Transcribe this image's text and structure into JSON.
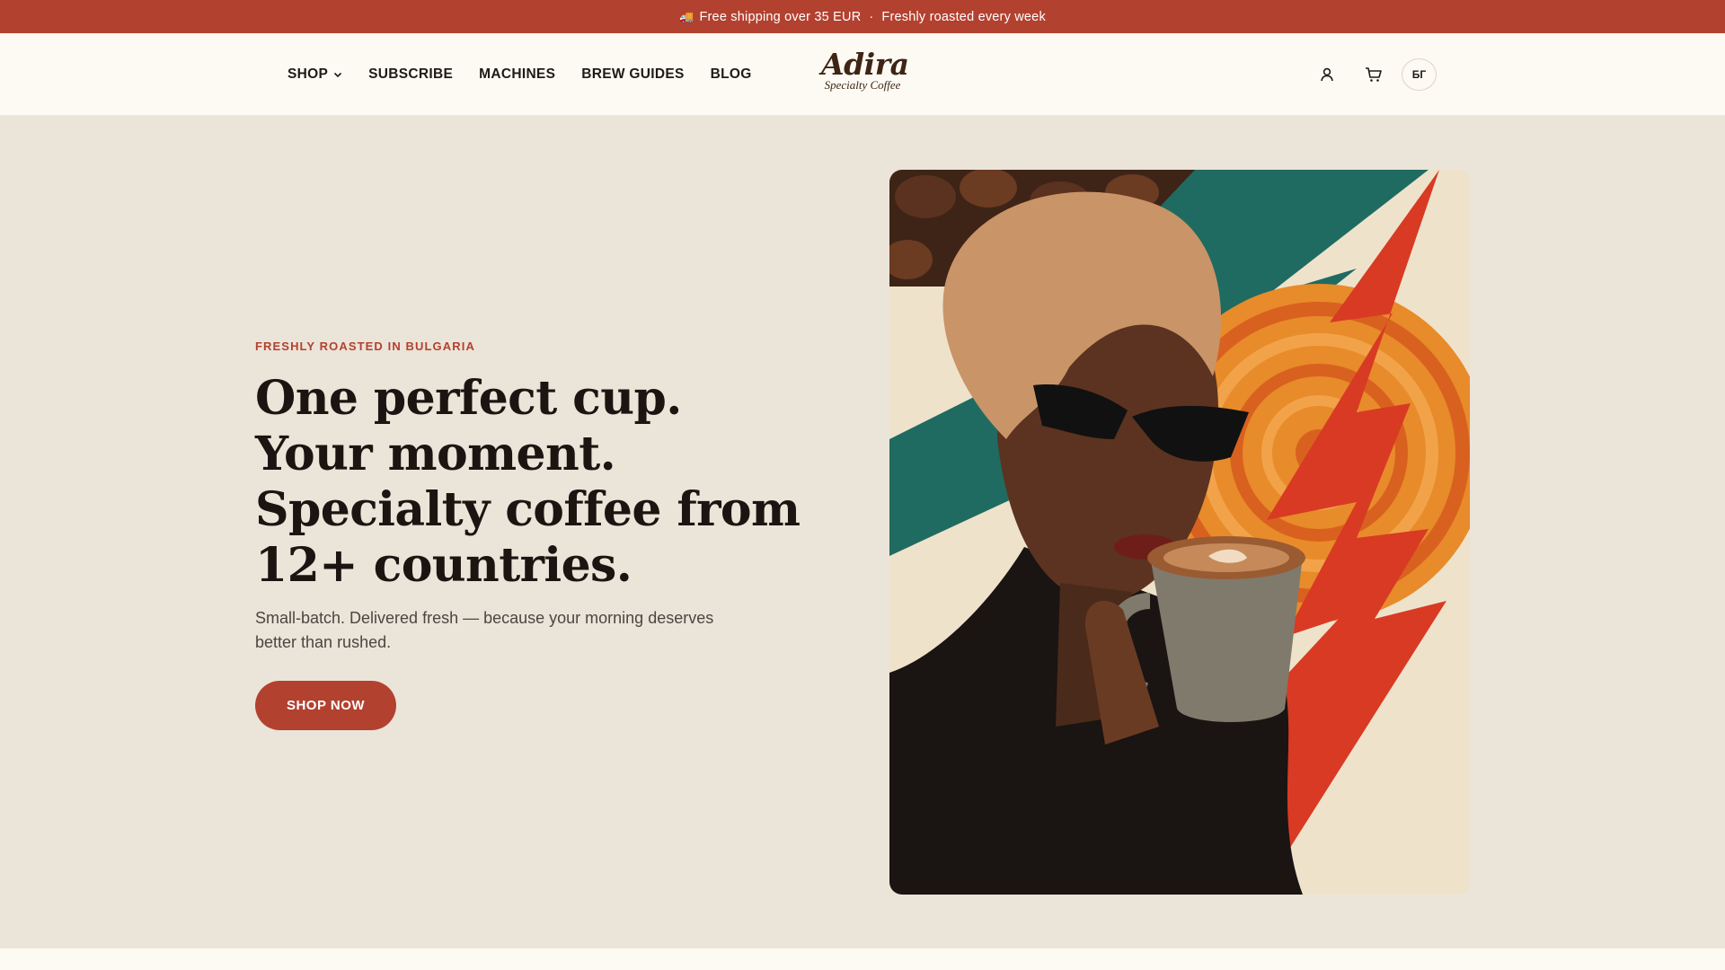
{
  "announcement": {
    "icon": "truck-icon",
    "text1": "Free shipping over 35 EUR",
    "separator": "·",
    "text2": "Freshly roasted every week"
  },
  "nav": {
    "items": [
      {
        "label": "SHOP",
        "has_dropdown": true
      },
      {
        "label": "SUBSCRIBE"
      },
      {
        "label": "MACHINES"
      },
      {
        "label": "BREW GUIDES"
      },
      {
        "label": "BLOG"
      }
    ]
  },
  "logo": {
    "name": "Adira",
    "tagline": "Specialty Coffee"
  },
  "header_actions": {
    "account_icon": "user-icon",
    "cart_icon": "cart-icon",
    "language": "БГ"
  },
  "hero": {
    "eyebrow": "FRESHLY ROASTED IN BULGARIA",
    "headline": "One perfect cup. Your moment. Specialty coffee from 12+ countries.",
    "subtext": "Small-batch. Delivered fresh — because your morning deserves better than rushed.",
    "cta_label": "SHOP NOW"
  },
  "colors": {
    "accent": "#b3412f",
    "hero_background": "#ebe4d9",
    "page_background": "#fdfaf3",
    "text": "#1f1a17"
  }
}
